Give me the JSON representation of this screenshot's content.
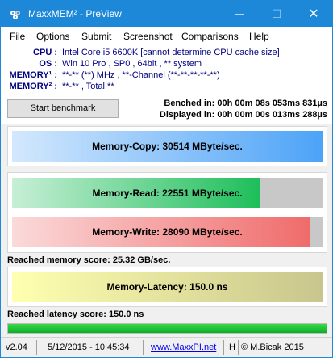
{
  "window": {
    "title": "MaxxMEM² - PreView",
    "min_glyph": "─",
    "max_glyph": "☐",
    "close_glyph": "✕"
  },
  "menu": [
    "File",
    "Options",
    "Submit",
    "Screenshot",
    "Comparisons",
    "Help"
  ],
  "info": {
    "cpu_label": "CPU :",
    "cpu_value": "Intel Core i5 6600K  [cannot determine CPU cache size]",
    "os_label": "OS :",
    "os_value": "Win 10 Pro , SP0 , 64bit , ** system",
    "mem1_label": "MEMORY¹ :",
    "mem1_value": "**-** (**) MHz , **-Channel (**-**-**-**-**)",
    "mem2_label": "MEMORY² :",
    "mem2_value": "**-** , Total **"
  },
  "bench": {
    "start_label": "Start benchmark",
    "benched": "Benched in: 00h 00m 08s 053ms 831µs",
    "displayed": "Displayed in: 00h 00m 00s 013ms 288µs"
  },
  "results": {
    "copy": {
      "label": "Memory-Copy: 30514 MByte/sec.",
      "fraction": 1.0,
      "color": "#4da3f7"
    },
    "read": {
      "label": "Memory-Read: 22551 MByte/sec.",
      "fraction": 0.8,
      "color": "#1ebe5a"
    },
    "write": {
      "label": "Memory-Write: 28090 MByte/sec.",
      "fraction": 0.96,
      "color": "#f06b6b"
    },
    "memory_score": "Reached memory score: 25.32 GB/sec.",
    "latency": {
      "label": "Memory-Latency: 150.0 ns",
      "fraction": 1.0,
      "color": "#c8c68c"
    },
    "latency_score": "Reached latency score: 150.0 ns"
  },
  "progress": {
    "fraction": 1.0
  },
  "status": {
    "version": "v2.04",
    "datetime": "5/12/2015 - 10:45:34",
    "url": "www.MaxxPI.net",
    "h": "H",
    "copyright": "© M.Bicak 2015"
  }
}
